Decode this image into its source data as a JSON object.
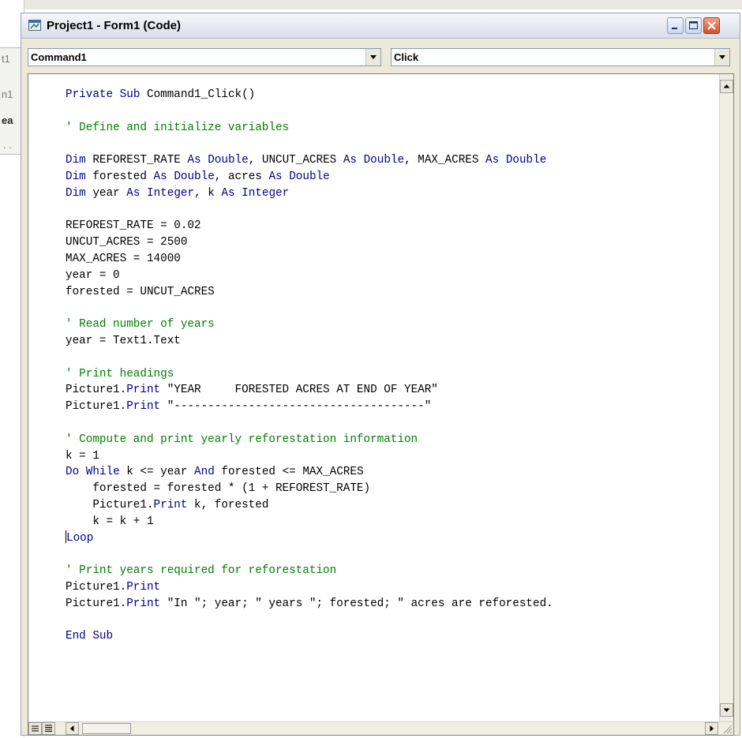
{
  "window": {
    "title": "Project1 - Form1 (Code)"
  },
  "background": {
    "fragments": [
      "t1",
      "n1",
      "ea",
      ". ."
    ]
  },
  "object_combo": {
    "selected": "Command1"
  },
  "procedure_combo": {
    "selected": "Click"
  },
  "icons": {
    "window_icon": "vb-code-window-icon",
    "minimize": "minimize-icon",
    "maximize": "maximize-icon",
    "close": "close-icon"
  },
  "colors": {
    "keyword": "#00008b",
    "comment": "#008000",
    "text": "#000000"
  },
  "code": {
    "lines": [
      "Private Sub Command1_Click()",
      "",
      "' Define and initialize variables",
      "",
      "Dim REFOREST_RATE As Double, UNCUT_ACRES As Double, MAX_ACRES As Double",
      "Dim forested As Double, acres As Double",
      "Dim year As Integer, k As Integer",
      "",
      "REFOREST_RATE = 0.02",
      "UNCUT_ACRES = 2500",
      "MAX_ACRES = 14000",
      "year = 0",
      "forested = UNCUT_ACRES",
      "",
      "' Read number of years",
      "year = Text1.Text",
      "",
      "' Print headings",
      "Picture1.Print \"YEAR     FORESTED ACRES AT END OF YEAR\"",
      "Picture1.Print \"-------------------------------------\"",
      "",
      "' Compute and print yearly reforestation information",
      "k = 1",
      "Do While k <= year And forested <= MAX_ACRES",
      "    forested = forested * (1 + REFOREST_RATE)",
      "    Picture1.Print k, forested",
      "    k = k + 1",
      "Loop",
      "",
      "' Print years required for reforestation",
      "Picture1.Print",
      "Picture1.Print \"In \"; year; \" years \"; forested; \" acres are reforested.",
      "",
      "End Sub"
    ]
  }
}
